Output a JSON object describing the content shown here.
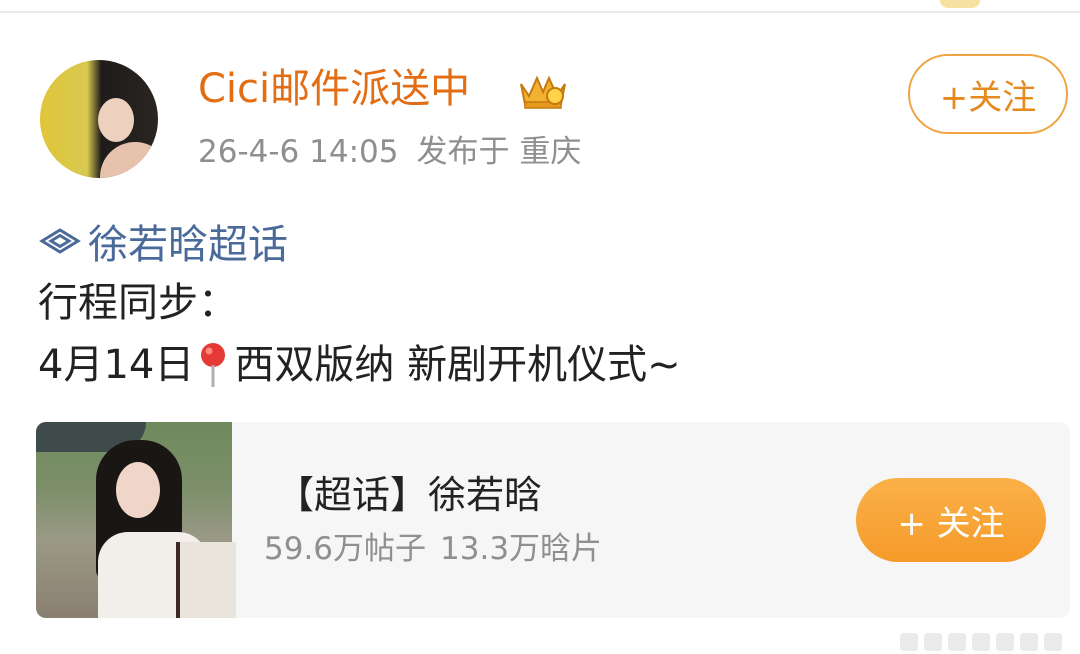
{
  "post": {
    "username": "Cici邮件派送中",
    "badge_icon": "crown-badge-icon",
    "date": "26-4-6 14:05",
    "published_from": "发布于 重庆",
    "follow_label": "+关注"
  },
  "content": {
    "topic_icon": "supertopic-diamond-icon",
    "topic": "徐若晗超话",
    "line1": "行程同步：",
    "line2_date": "4月14日",
    "line2_icon": "location-pin-icon",
    "line2_rest": "西双版纳 新剧开机仪式~"
  },
  "card": {
    "title": "【超话】徐若晗",
    "posts": "59.6万帖子",
    "fans": "13.3万晗片",
    "follow_label": "+ 关注"
  },
  "colors": {
    "username": "#e26d13",
    "topic": "#4a6a9a",
    "follow_outline": "#f0a341",
    "follow_filled": "#f59a2a",
    "meta_gray": "#8f8f8f"
  }
}
